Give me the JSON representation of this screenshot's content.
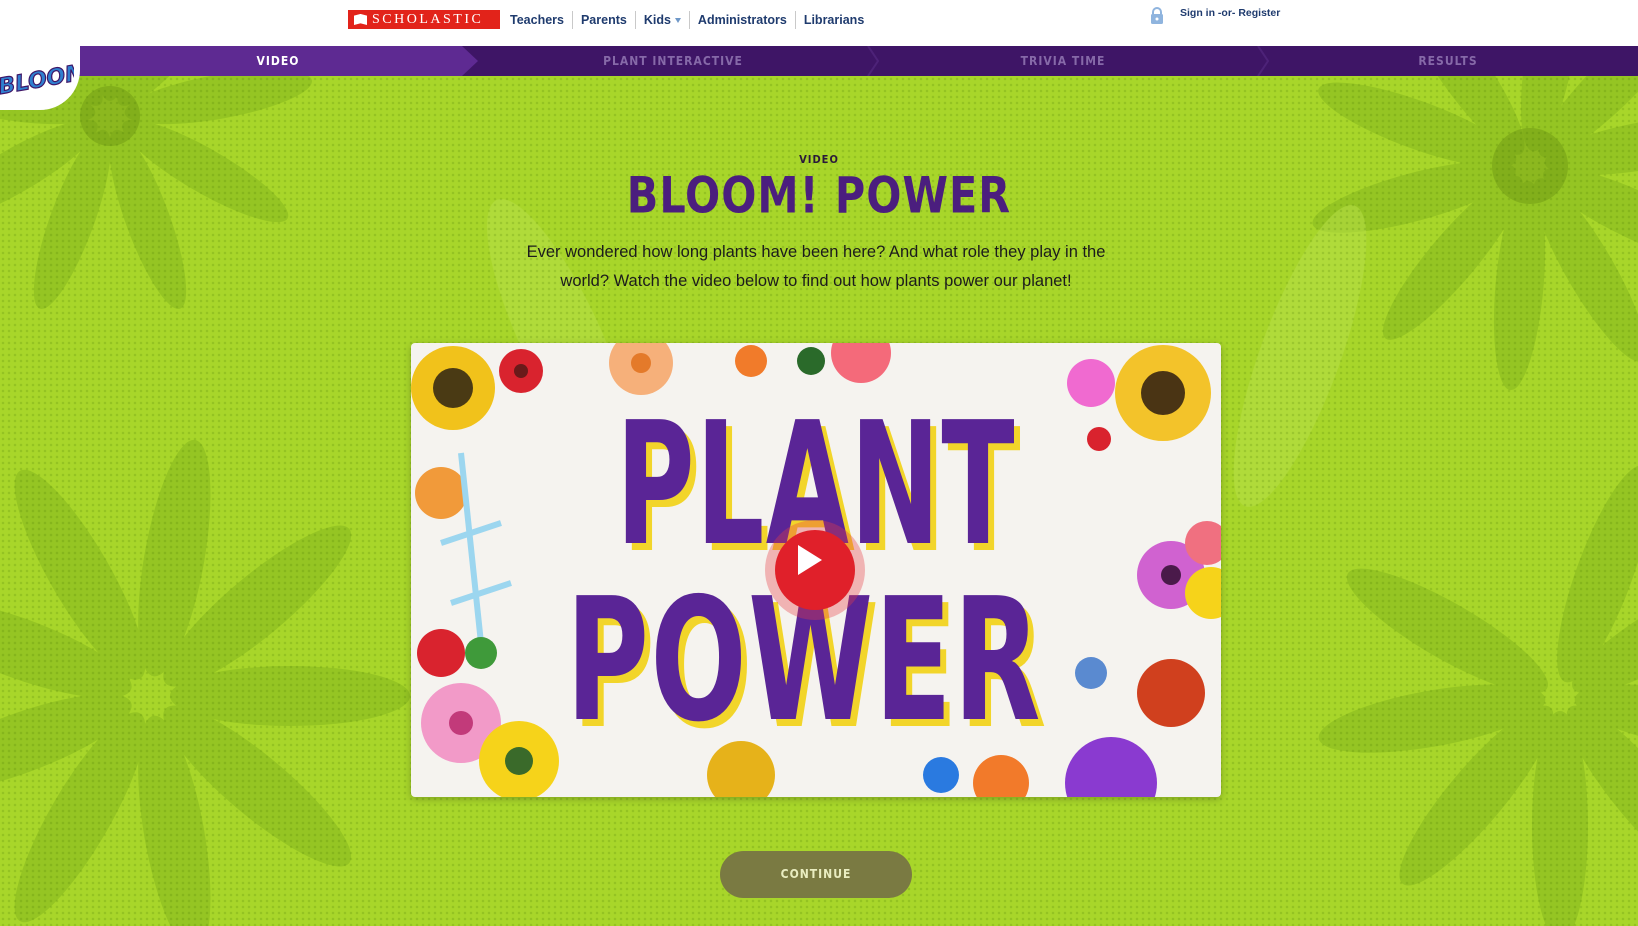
{
  "topbar": {
    "brand": "SCHOLASTIC",
    "nav": [
      "Teachers",
      "Parents",
      "Kids",
      "Administrators",
      "Librarians"
    ],
    "signin": "Sign in",
    "or": "-or-",
    "register": "Register"
  },
  "steps": [
    {
      "label": "VIDEO",
      "state": "active"
    },
    {
      "label": "PLANT INTERACTIVE",
      "state": "upcoming"
    },
    {
      "label": "TRIVIA TIME",
      "state": "upcoming"
    },
    {
      "label": "RESULTS",
      "state": "upcoming"
    }
  ],
  "badge": {
    "text": "BLOOM!"
  },
  "header": {
    "eyebrow": "VIDEO",
    "title": "BLOOM! POWER",
    "intro": "Ever wondered how long plants have been here? And what role they play in the world? Watch the video below to find out how plants power our planet!"
  },
  "video": {
    "line1": "PLANT",
    "line2": "POWER",
    "play_icon": "play-icon"
  },
  "continue_label": "CONTINUE",
  "colors": {
    "background": "#a8d62a",
    "purple_dark": "#3e1566",
    "purple_active": "#5e2a92",
    "title_purple": "#4b1e7e",
    "play_red": "#e0202a",
    "brand_red": "#e2231a",
    "continue_bg": "#7a7a42"
  }
}
